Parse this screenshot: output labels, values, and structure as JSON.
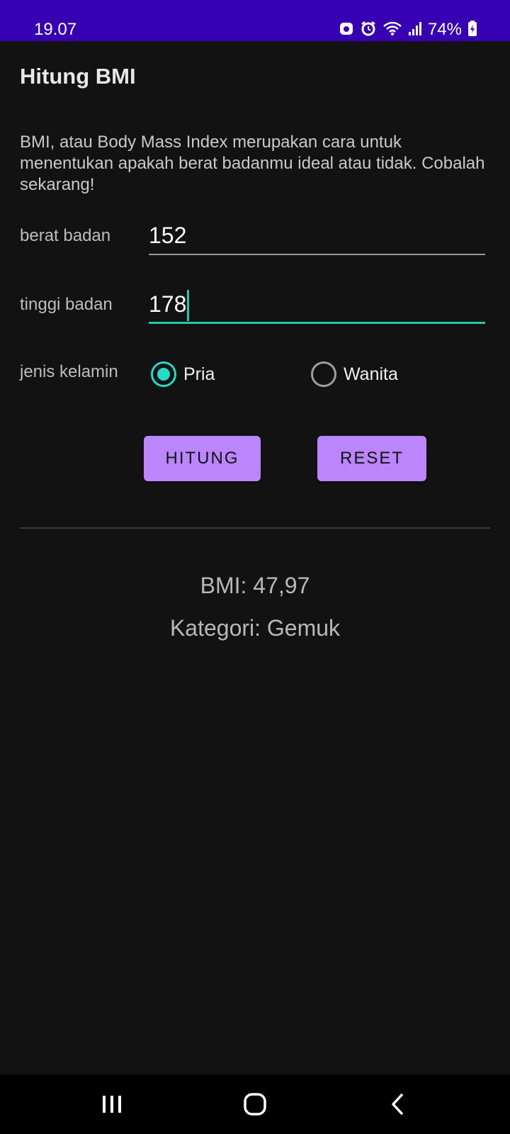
{
  "status_bar": {
    "time": "19.07",
    "battery": "74%"
  },
  "app": {
    "title": "Hitung BMI",
    "description": "BMI, atau Body Mass Index merupakan cara untuk menentukan apakah berat badanmu ideal atau tidak. Cobalah sekarang!"
  },
  "form": {
    "weight_label": "berat badan",
    "weight_value": "152",
    "height_label": "tinggi badan",
    "height_value": "178",
    "gender_label": "jenis kelamin",
    "gender_options": [
      {
        "label": "Pria",
        "checked": true
      },
      {
        "label": "Wanita",
        "checked": false
      }
    ]
  },
  "buttons": {
    "calculate_label": "HITUNG",
    "reset_label": "RESET"
  },
  "result": {
    "bmi_text": "BMI: 47,97",
    "category_text": "Kategori: Gemuk"
  },
  "colors": {
    "status_bar": "#3700b3",
    "background": "#121212",
    "accent": "#26d9c4",
    "button": "#bb86fc"
  }
}
